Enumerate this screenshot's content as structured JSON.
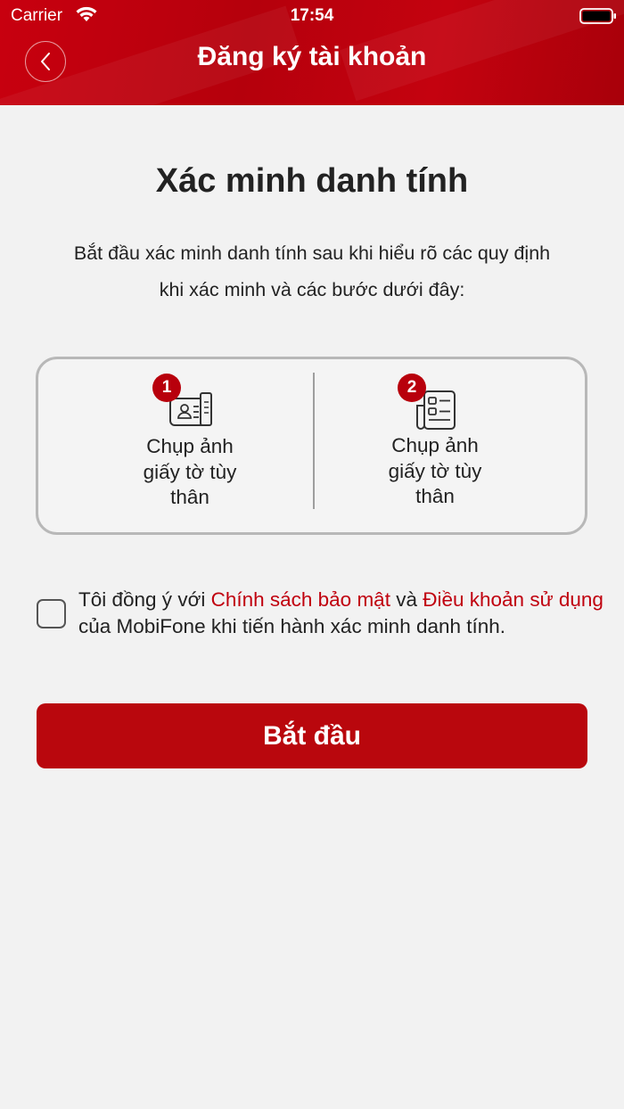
{
  "status_bar": {
    "carrier": "Carrier",
    "time": "17:54",
    "icons": [
      "wifi-icon",
      "battery-icon"
    ]
  },
  "nav": {
    "title": "Đăng ký tài khoản",
    "back_icon": "chevron-left-icon"
  },
  "content": {
    "title": "Xác minh danh tính",
    "intro_line1": "Bắt đầu xác minh danh tính sau khi hiểu rõ các quy định",
    "intro_line2": "khi xác minh và các bước dưới đây:"
  },
  "steps": [
    {
      "number": "1",
      "icon": "id-card-icon",
      "label_lines": [
        "Chụp ảnh",
        "giấy tờ tùy",
        "thân"
      ]
    },
    {
      "number": "2",
      "icon": "document-icon",
      "label_lines": [
        "Chụp ảnh",
        "giấy tờ tùy",
        "thân"
      ]
    }
  ],
  "agreement": {
    "prefix": "Tôi đồng ý với ",
    "privacy_link": "Chính sách bảo mật",
    "middle": " và ",
    "terms_link": "Điều khoản sử dụng",
    "suffix": " của MobiFone khi tiến hành xác minh danh tính.",
    "checked": false
  },
  "start_button": {
    "label": "Bắt đầu"
  },
  "colors": {
    "brand_red": "#b9070d",
    "link_red": "#c0000e",
    "background": "#f2f2f2"
  }
}
